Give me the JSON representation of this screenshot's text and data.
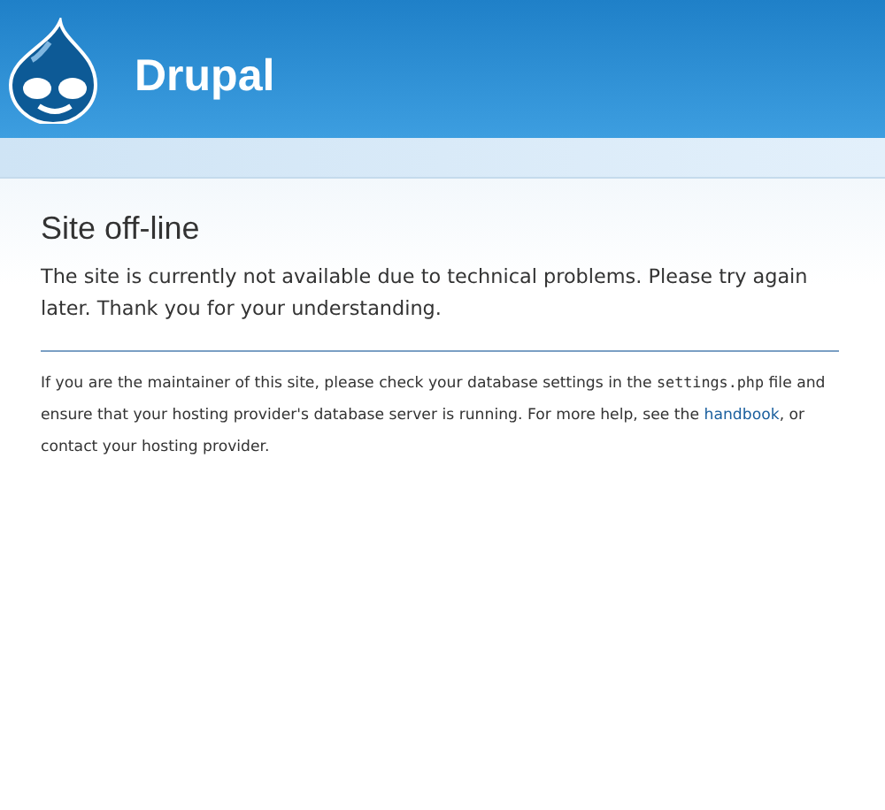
{
  "header": {
    "site_name": "Drupal"
  },
  "page": {
    "title": "Site off-line",
    "message": "The site is currently not available due to technical problems. Please try again later. Thank you for your understanding.",
    "details": [
      {
        "kind": "text",
        "text": "If you are the maintainer of this site, please check your database settings in the "
      },
      {
        "kind": "code",
        "text": "settings.php"
      },
      {
        "kind": "text",
        "text": " file and ensure that your hosting provider's database server is running. For more help, see the "
      },
      {
        "kind": "link",
        "text": "handbook"
      },
      {
        "kind": "text",
        "text": ", or contact your hosting provider."
      }
    ]
  }
}
